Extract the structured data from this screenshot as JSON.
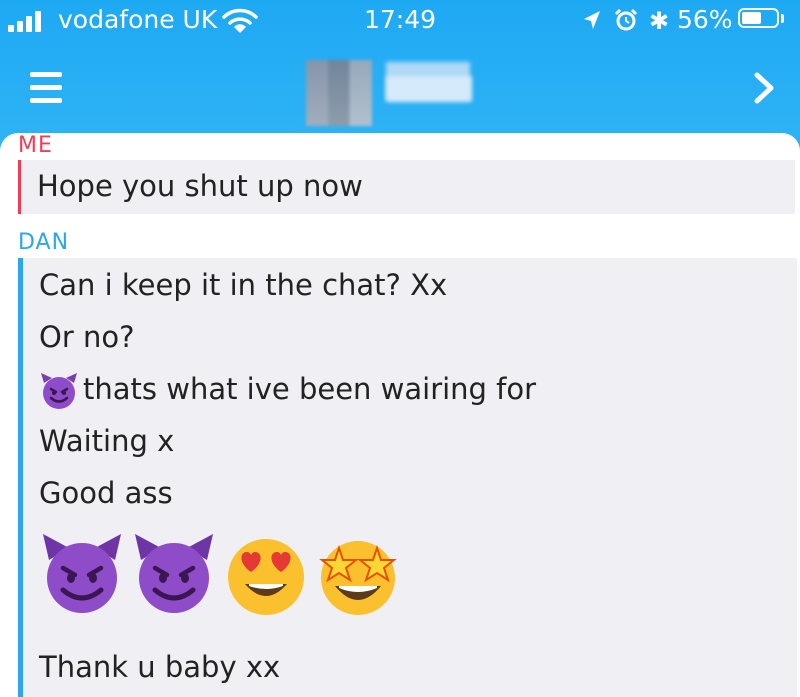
{
  "status_bar": {
    "carrier": "vodafone UK",
    "time": "17:49",
    "battery_percent": "56%",
    "battery_level": 0.56
  },
  "header": {
    "contact_name": "███",
    "icons": [
      "menu-icon",
      "chevron-right-icon"
    ]
  },
  "conversation": {
    "me": {
      "label": "ME",
      "color": "#f23c57",
      "messages": [
        "Hope you shut up now"
      ]
    },
    "dan": {
      "label": "DAN",
      "color": "#2ba7f0",
      "messages": [
        "Can i keep it in the chat? Xx",
        "Or no?",
        "thats what ive been wairing  for",
        "Waiting x",
        "Good ass",
        "Thank u baby xx"
      ],
      "emoji_inline": "smiling-devil",
      "emoji_row": [
        "smiling-devil",
        "smiling-devil",
        "heart-eyes",
        "star-struck"
      ]
    }
  },
  "colors": {
    "header": "#2baff4",
    "bubble_bg": "#efeff4"
  }
}
